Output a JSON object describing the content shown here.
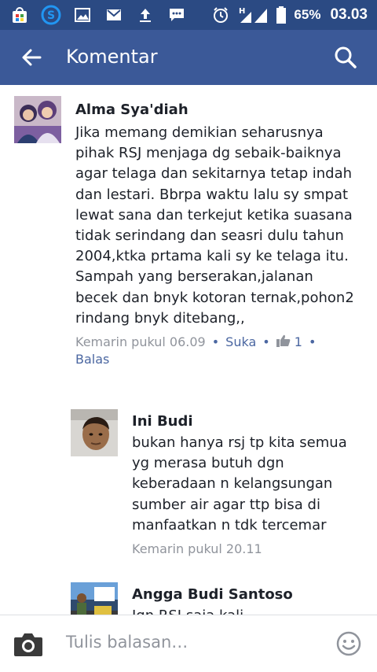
{
  "status_bar": {
    "battery": "65%",
    "time": "03.03",
    "network": "H",
    "icons": [
      "store-icon",
      "s-app-icon",
      "gallery-icon",
      "mail-icon",
      "upload-icon",
      "chat-icon",
      "alarm-icon",
      "signal-icon",
      "battery-icon"
    ]
  },
  "app_bar": {
    "title": "Komentar",
    "back_icon": "back-arrow-icon",
    "search_icon": "search-icon"
  },
  "comments": [
    {
      "author": "Alma Sya'diah",
      "text": "Jika memang demikian seharusnya pihak RSJ menjaga dg sebaik-baiknya agar telaga dan sekitarnya tetap indah dan lestari. Bbrpa waktu lalu sy smpat lewat sana dan terkejut ketika suasana tidak serindang dan seasri dulu tahun 2004,ktka prtama kali sy ke telaga itu. Sampah yang berserakan,jalanan becek dan bnyk kotoran ternak,pohon2 rindang bnyk ditebang,,",
      "timestamp": "Kemarin pukul 06.09",
      "like_label": "Suka",
      "like_count": "1",
      "reply_label": "Balas"
    },
    {
      "author": "Ini Budi",
      "text": "bukan hanya rsj tp kita semua yg merasa butuh dgn keberadaan n kelangsungan sumber air agar ttp bisa di manfaatkan n tdk tercemar",
      "timestamp": "Kemarin pukul 20.11"
    },
    {
      "author": "Angga Budi Santoso",
      "text": "Jgn RSJ saja kali"
    }
  ],
  "reply_bar": {
    "placeholder": "Tulis balasan…",
    "camera_icon": "camera-icon",
    "emoji_icon": "emoji-icon"
  },
  "colors": {
    "status_bar": "#2b4a83",
    "app_bar": "#3b5998",
    "link": "#4b67a1",
    "meta": "#90949c",
    "text": "#1d2129"
  }
}
